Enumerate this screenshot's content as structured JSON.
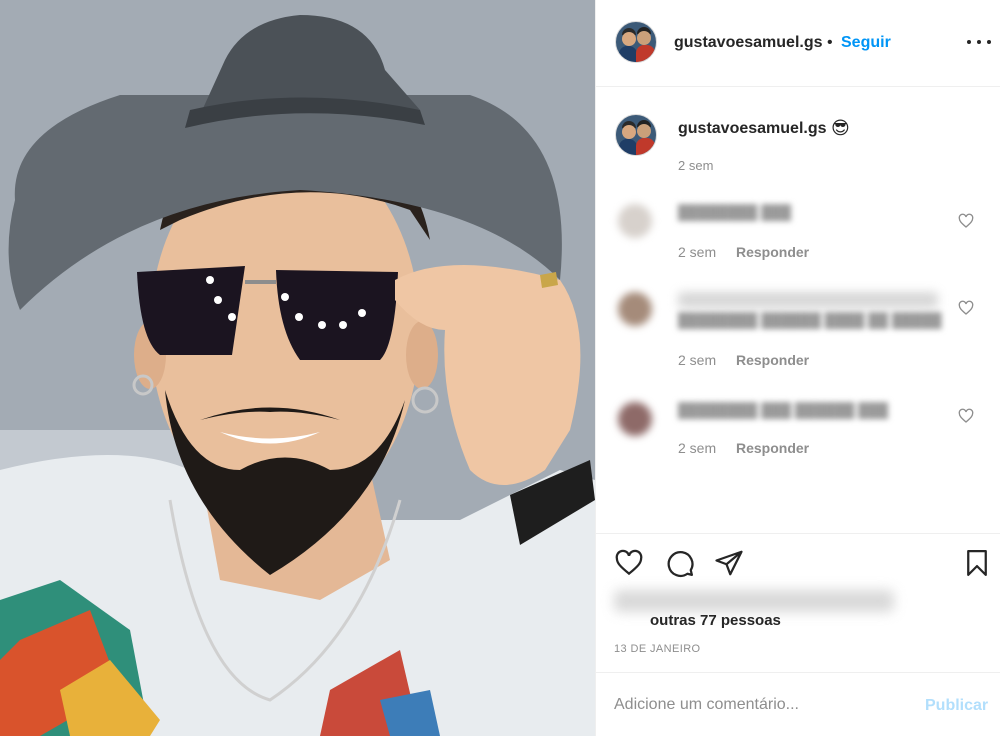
{
  "post": {
    "username": "gustavoesamuel.gs",
    "separator": "•",
    "follow_label": "Seguir",
    "caption_emoji": "😎",
    "caption_time": "2 sem"
  },
  "comments": [
    {
      "time": "2 sem",
      "reply_label": "Responder",
      "text": "████████ ███"
    },
    {
      "time": "2 sem",
      "reply_label": "Responder",
      "text": "████████ ██████ ████ ██ █████"
    },
    {
      "time": "2 sem",
      "reply_label": "Responder",
      "text": "████████ ███ ██████ ███"
    }
  ],
  "likes": {
    "text": "outras 77 pessoas"
  },
  "date": "13 DE JANEIRO",
  "comment_box": {
    "placeholder": "Adicione um comentário...",
    "publish_label": "Publicar"
  },
  "icons": {
    "more": "more-options-icon",
    "like": "heart-icon",
    "comment": "comment-icon",
    "share": "paper-plane-icon",
    "save": "bookmark-icon"
  },
  "colors": {
    "accent": "#0095f6",
    "publish_disabled": "#b2dffc",
    "muted": "#8e8e8e",
    "text": "#262626"
  }
}
